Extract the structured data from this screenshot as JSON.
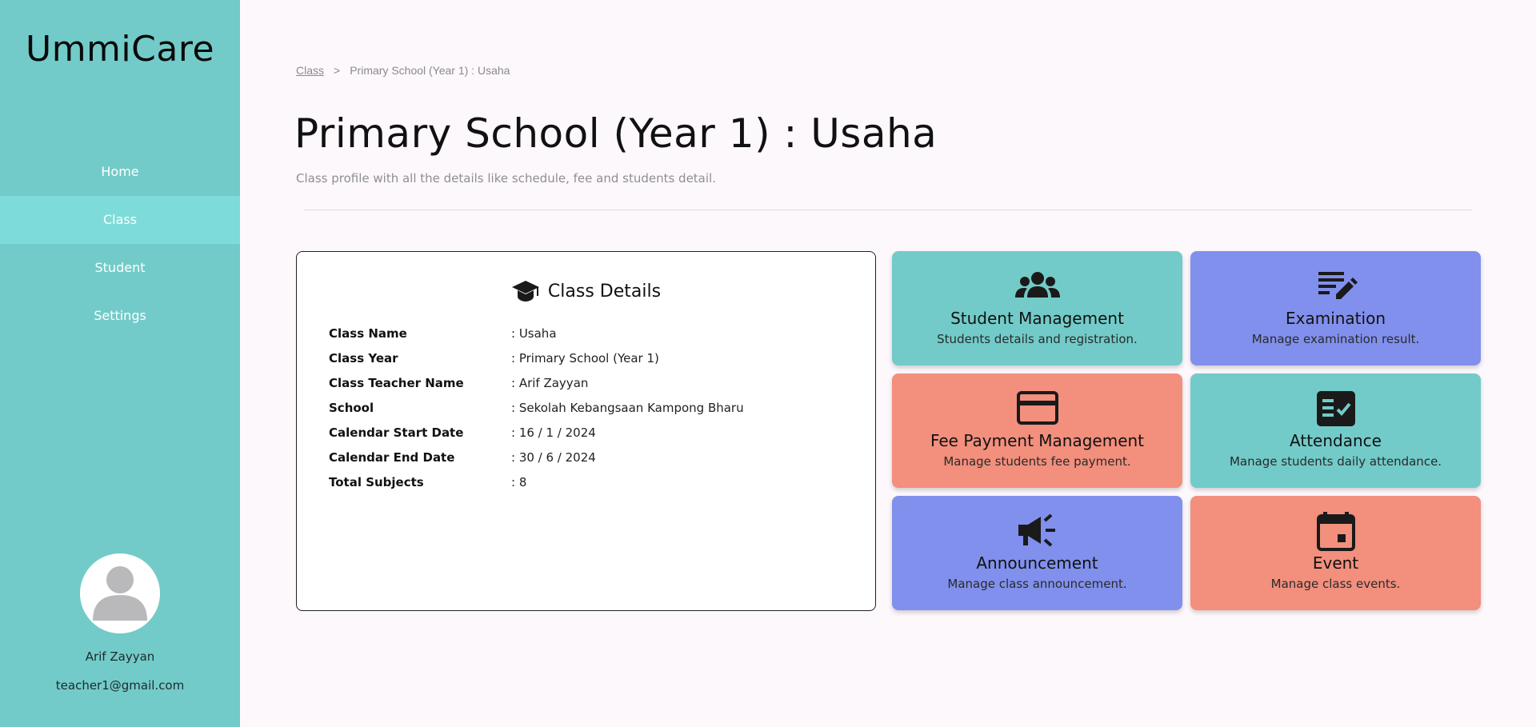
{
  "sidebar": {
    "logo": "UmmiCare",
    "nav": [
      {
        "label": "Home",
        "active": false
      },
      {
        "label": "Class",
        "active": true
      },
      {
        "label": "Student",
        "active": false
      },
      {
        "label": "Settings",
        "active": false
      }
    ],
    "user": {
      "name": "Arif Zayyan",
      "email": "teacher1@gmail.com",
      "avatar_icon": "user-avatar-icon"
    }
  },
  "breadcrumb": {
    "link": "Class",
    "separator": ">",
    "current": "Primary School (Year 1) : Usaha"
  },
  "page": {
    "title": "Primary School (Year 1) : Usaha",
    "subtitle": "Class profile with all the details like schedule, fee and students detail."
  },
  "details": {
    "icon": "graduation-cap-icon",
    "title": "Class Details",
    "rows": [
      {
        "label": "Class Name",
        "value": ": Usaha"
      },
      {
        "label": "Class Year",
        "value": ": Primary School (Year 1)"
      },
      {
        "label": "Class Teacher Name",
        "value": ": Arif Zayyan"
      },
      {
        "label": "School",
        "value": ": Sekolah Kebangsaan Kampong Bharu"
      },
      {
        "label": "Calendar Start Date",
        "value": ": 16 / 1 / 2024"
      },
      {
        "label": "Calendar End Date",
        "value": ": 30 / 6 / 2024"
      },
      {
        "label": "Total Subjects",
        "value": ": 8"
      }
    ]
  },
  "tiles": [
    {
      "title": "Student Management",
      "desc": "Students details and registration.",
      "icon": "groups-icon",
      "color": "#72cbc9"
    },
    {
      "title": "Examination",
      "desc": "Manage examination result.",
      "icon": "edit-note-icon",
      "color": "#8190ec"
    },
    {
      "title": "Fee Payment Management",
      "desc": "Manage students fee payment.",
      "icon": "credit-card-icon",
      "color": "#f28f7d"
    },
    {
      "title": "Attendance",
      "desc": "Manage students daily attendance.",
      "icon": "checklist-icon",
      "color": "#72cbc9"
    },
    {
      "title": "Announcement",
      "desc": "Manage class announcement.",
      "icon": "megaphone-icon",
      "color": "#8190ec"
    },
    {
      "title": "Event",
      "desc": "Manage class events.",
      "icon": "calendar-event-icon",
      "color": "#f28f7d"
    }
  ]
}
